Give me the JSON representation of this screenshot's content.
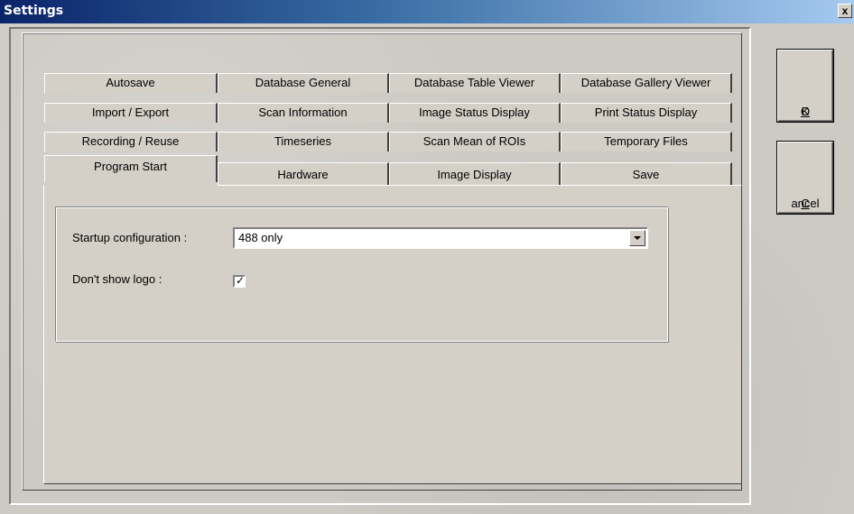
{
  "window": {
    "title": "Settings",
    "close_label": "x"
  },
  "tabs": {
    "row1": [
      "Autosave",
      "Database General",
      "Database Table Viewer",
      "Database Gallery Viewer"
    ],
    "row2": [
      "Import / Export",
      "Scan Information",
      "Image Status Display",
      "Print Status Display"
    ],
    "row3": [
      "Recording / Reuse",
      "Timeseries",
      "Scan Mean of ROIs",
      "Temporary Files"
    ],
    "row4": [
      "Program Start",
      "Hardware",
      "Image Display",
      "Save"
    ],
    "active": "Program Start"
  },
  "program_start": {
    "startup_label": "Startup configuration :",
    "startup_value": "488 only",
    "logo_label": "Don't show logo :",
    "logo_checked": true,
    "checkmark_glyph": "✓"
  },
  "buttons": {
    "ok_mnemonic": "O",
    "ok_rest": "K",
    "cancel_mnemonic": "C",
    "cancel_rest": "ancel"
  }
}
